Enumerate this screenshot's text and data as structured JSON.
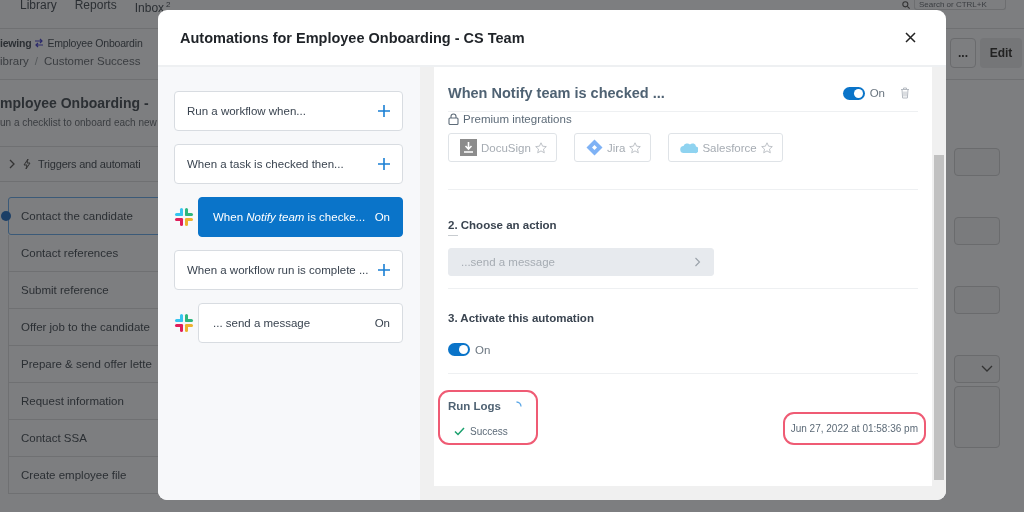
{
  "app": {
    "nav": [
      {
        "label": "Library"
      },
      {
        "label": "Reports"
      },
      {
        "label": "Inbox",
        "badge": "2"
      }
    ],
    "search": {
      "placeholder": "Search or CTRL+K"
    },
    "breadcrumb": {
      "viewing": "iewing",
      "template": "Employee Onboardin",
      "path": [
        "ibrary",
        "Customer Success"
      ],
      "separator": "/"
    },
    "buttons": [
      {
        "label": "...",
        "kind": "more"
      },
      {
        "label": "Edit",
        "kind": "primary"
      }
    ],
    "title": "mployee Onboarding -",
    "subtitle": "un a checklist to onboard each new",
    "triggers_label": "Triggers and automati",
    "tasks": [
      {
        "label": "Contact the candidate",
        "selected": true
      },
      {
        "label": "Contact references",
        "selected": false
      },
      {
        "label": "Submit reference",
        "selected": false
      },
      {
        "label": "Offer job to the candidate",
        "selected": false
      },
      {
        "label": "Prepare & send offer lette",
        "selected": false
      },
      {
        "label": "Request information",
        "selected": false
      },
      {
        "label": "Contact SSA",
        "selected": false
      },
      {
        "label": "Create employee file",
        "selected": false
      }
    ],
    "fields": [
      {
        "kind": "text"
      },
      {
        "kind": "text"
      },
      {
        "kind": "text"
      },
      {
        "kind": "select"
      },
      {
        "kind": "area"
      }
    ]
  },
  "modal": {
    "title": "Automations for Employee Onboarding - CS Team",
    "automations": [
      {
        "kind": "add",
        "label": "Run a workflow when...",
        "selected": false
      },
      {
        "kind": "add",
        "label": "When a task is checked then...",
        "selected": false
      },
      {
        "kind": "rule",
        "label": "When *Notify team* is checke...",
        "status": "On",
        "selected": true
      },
      {
        "kind": "add",
        "label": "When a workflow run is complete ...",
        "selected": false
      },
      {
        "kind": "rule",
        "label": "... send a message",
        "status": "On",
        "selected": false
      }
    ],
    "detail": {
      "title": "When Notify team is checked ...",
      "enabled": true,
      "toggle_label": "On",
      "premium_label": "Premium integrations",
      "integrations": [
        {
          "kind": "docusign",
          "label": "DocuSign"
        },
        {
          "kind": "jira",
          "label": "Jira"
        },
        {
          "kind": "salesforce",
          "label": "Salesforce"
        }
      ],
      "step2": "2. Choose an action",
      "action": {
        "value": "...send a message",
        "disabled": true
      },
      "step3": "3. Activate this automation",
      "activate": {
        "on": true,
        "label": "On"
      },
      "run_logs": {
        "title": "Run Logs",
        "status": "Success",
        "timestamp": "Jun 27, 2022 at 01:58:36 pm"
      }
    }
  }
}
